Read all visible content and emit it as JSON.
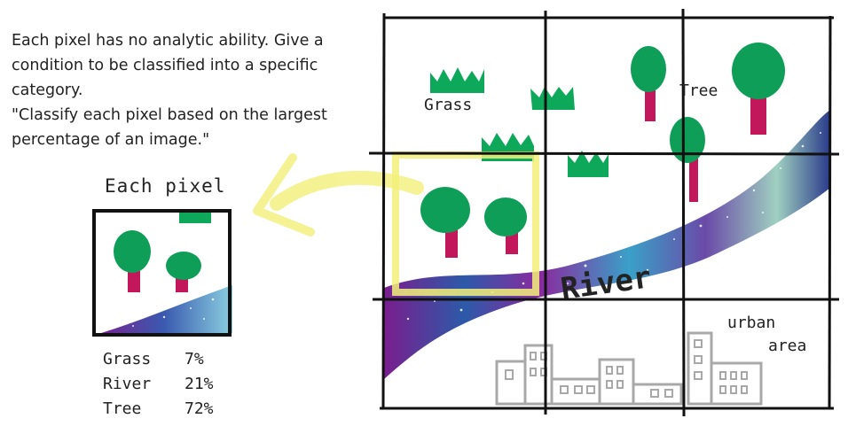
{
  "description": {
    "text": "Each pixel has no analytic ability. Give a\ncondition to be classified into a specific\ncategory.\n\"Classify each pixel based on  the largest\npercentage of an image.\""
  },
  "pixel_panel": {
    "title": "Each pixel",
    "stats": [
      {
        "category": "Grass",
        "percent": "7%"
      },
      {
        "category": "River",
        "percent": "21%"
      },
      {
        "category": "Tree",
        "percent": "72%"
      }
    ]
  },
  "image_labels": {
    "grass": "Grass",
    "tree": "Tree",
    "river": "River",
    "urban_line1": "urban",
    "urban_line2": "area"
  },
  "colors": {
    "grass": "#0ea85a",
    "tree_crown": "#0f9e57",
    "tree_trunk": "#c2185b",
    "highlight": "#f3f07a",
    "building": "#a8a8a8",
    "grid": "#111111"
  }
}
